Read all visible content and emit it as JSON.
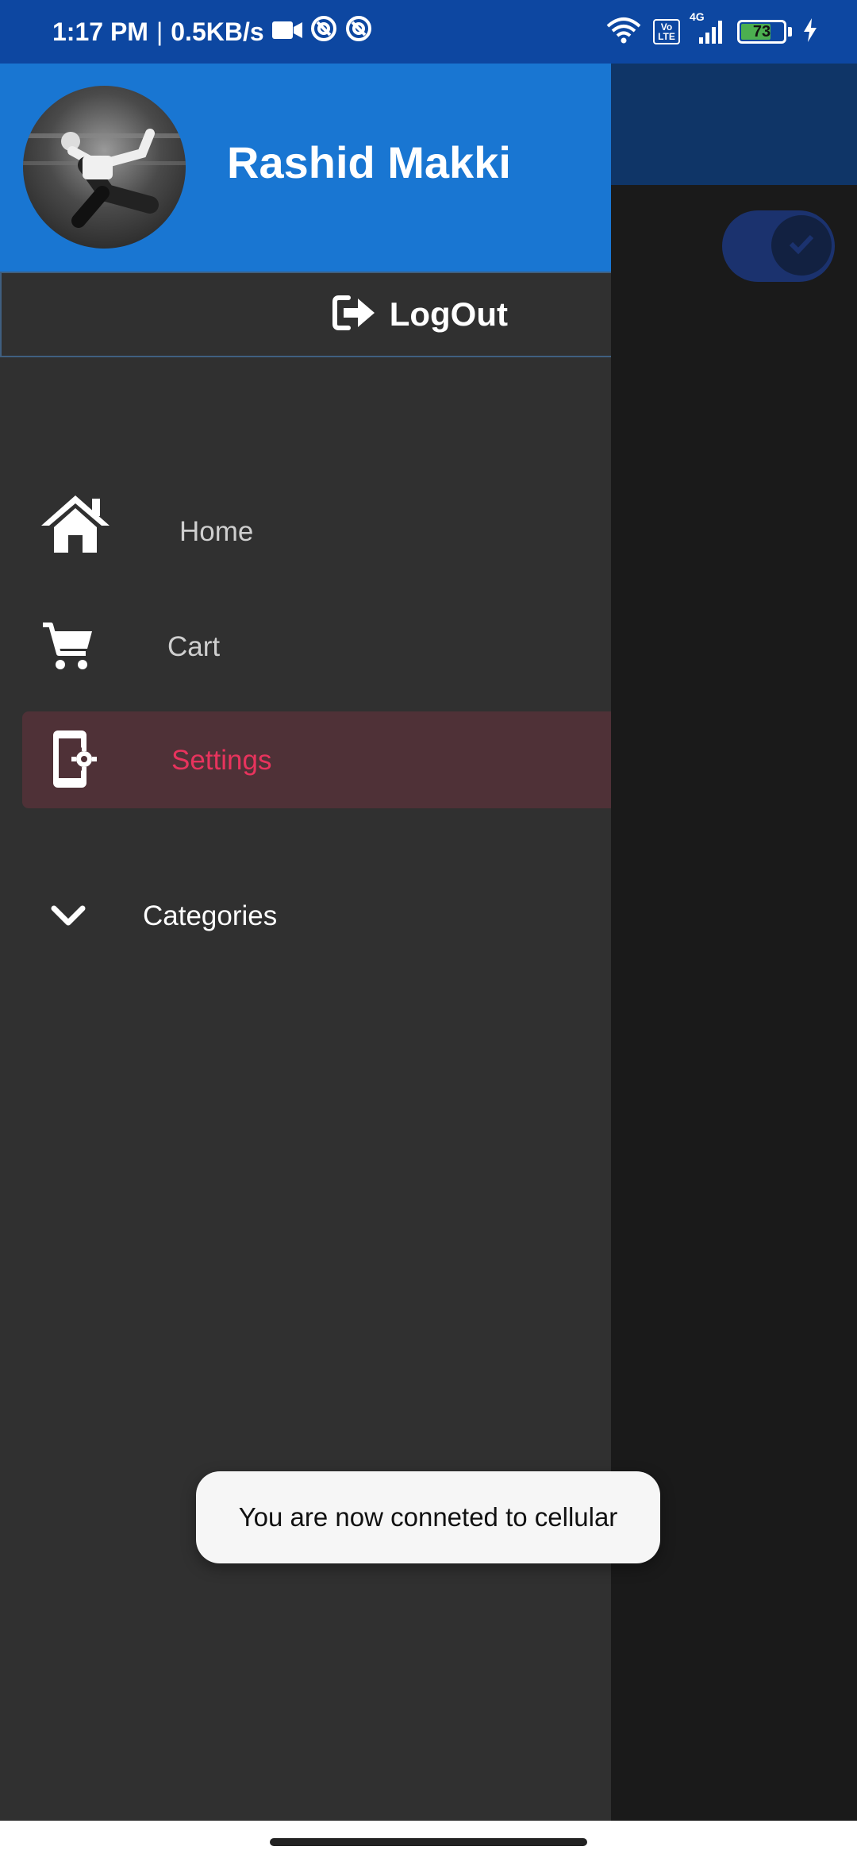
{
  "status_bar": {
    "time": "1:17 PM",
    "speed": "0.5KB/s",
    "network": "4G",
    "volte": "Vo LTE",
    "battery": "73",
    "battery_level": 0.73
  },
  "drawer": {
    "user_name": "Rashid Makki",
    "logout_label": "LogOut",
    "items": [
      {
        "label": "Home",
        "icon": "home-icon"
      },
      {
        "label": "Cart",
        "icon": "cart-icon"
      },
      {
        "label": "Settings",
        "icon": "settings-phone-icon",
        "selected": true
      },
      {
        "label": "Categories",
        "icon": "chevron-down-icon"
      }
    ]
  },
  "toast": {
    "text": "You are now conneted to cellular"
  },
  "colors": {
    "accent": "#e8335d",
    "header": "#1976d2",
    "status_bar": "#0d47a1",
    "drawer_bg": "#303030"
  }
}
